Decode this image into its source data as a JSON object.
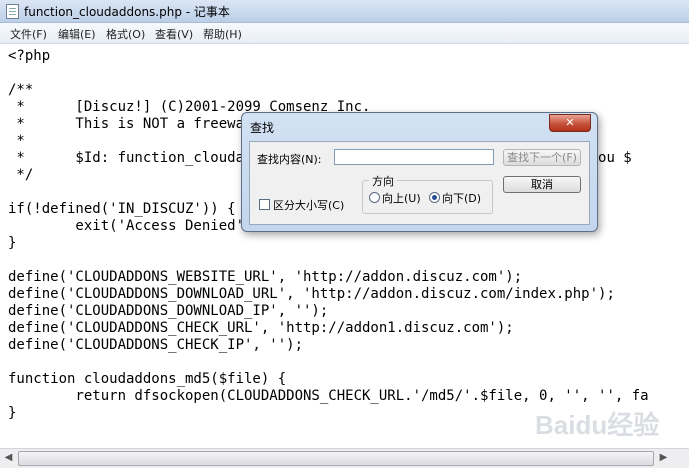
{
  "window": {
    "title": "function_cloudaddons.php - 记事本"
  },
  "menu": [
    "文件(F)",
    "编辑(E)",
    "格式(O)",
    "查看(V)",
    "帮助(H)"
  ],
  "code_lines": [
    "<?php",
    "",
    "/**",
    " *      [Discuz!] (C)2001-2099 Comsenz Inc.",
    " *      This is NOT a freeware, use is subject to license terms",
    " *",
    " *      $Id: function_cloudaddons.php 33806 2013-08-15 05:57:45Z nemohou $",
    " */",
    "",
    "if(!defined('IN_DISCUZ')) {",
    "        exit('Access Denied');",
    "}",
    "",
    "define('CLOUDADDONS_WEBSITE_URL', 'http://addon.discuz.com');",
    "define('CLOUDADDONS_DOWNLOAD_URL', 'http://addon.discuz.com/index.php');",
    "define('CLOUDADDONS_DOWNLOAD_IP', '');",
    "define('CLOUDADDONS_CHECK_URL', 'http://addon1.discuz.com');",
    "define('CLOUDADDONS_CHECK_IP', '');",
    "",
    "function cloudaddons_md5($file) {",
    "        return dfsockopen(CLOUDADDONS_CHECK_URL.'/md5/'.$file, 0, '', '', fa",
    "}"
  ],
  "find_dialog": {
    "title": "查找",
    "close_icon": "close-x-icon",
    "find_label": "查找内容(N):",
    "find_value": "",
    "find_next": "查找下一个(F)",
    "cancel": "取消",
    "direction_label": "方向",
    "up_label": "向上(U)",
    "down_label": "向下(D)",
    "match_case_label": "区分大小写(C)",
    "direction_selected": "down",
    "match_case": false
  },
  "watermark": "Baidu经验"
}
